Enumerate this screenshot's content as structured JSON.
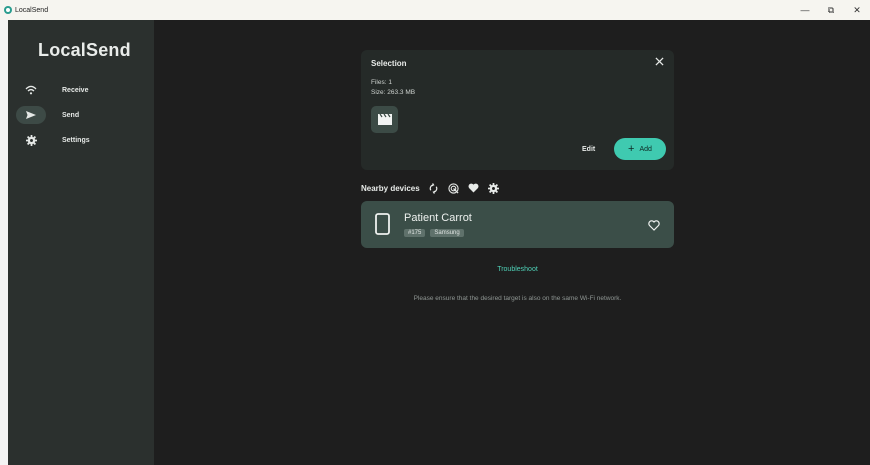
{
  "window": {
    "title": "LocalSend",
    "controls": {
      "minimize": "—",
      "maximize": "⧉",
      "close": "✕"
    }
  },
  "sidebar": {
    "brand": "LocalSend",
    "items": [
      {
        "label": "Receive",
        "icon": "wifi-icon",
        "active": false
      },
      {
        "label": "Send",
        "icon": "send-icon",
        "active": true
      },
      {
        "label": "Settings",
        "icon": "gear-icon",
        "active": false
      }
    ]
  },
  "selection": {
    "title": "Selection",
    "files": "Files: 1",
    "size": "Size: 263.3 MB",
    "thumb_icon": "video-clapper-icon",
    "edit_label": "Edit",
    "add_label": "Add"
  },
  "nearby": {
    "title": "Nearby devices",
    "tools": [
      "refresh-icon",
      "scan-target-icon",
      "heart-icon",
      "gear-icon"
    ]
  },
  "device": {
    "name": "Patient Carrot",
    "tags": [
      "#175",
      "Samsung"
    ],
    "icon": "phone-icon"
  },
  "troubleshoot_label": "Troubleshoot",
  "hint_text": "Please ensure that the desired target is also on the same Wi-Fi network.",
  "colors": {
    "accent": "#3fcab0",
    "sidebar_bg": "#2b302e",
    "main_bg": "#1e1e1e",
    "card_bg": "#252a28",
    "device_bg": "#3b4e48"
  }
}
